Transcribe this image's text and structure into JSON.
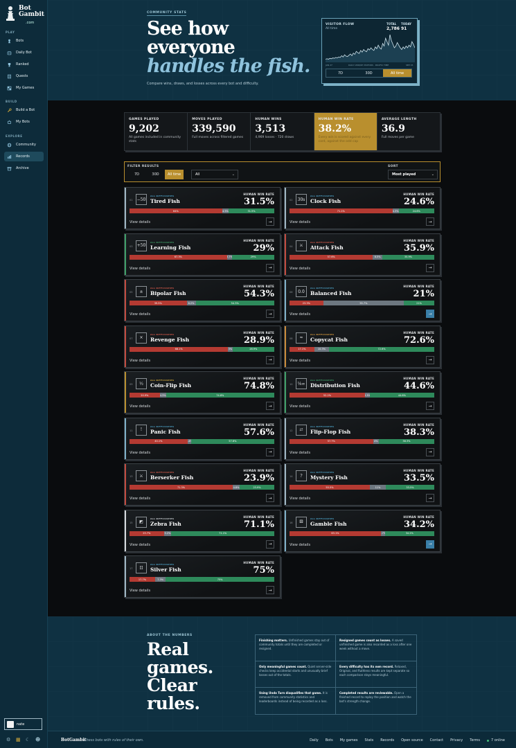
{
  "brand": {
    "line1": "Bot",
    "line2": "Gambit",
    "domain": ".com"
  },
  "sidebar": {
    "play_label": "PLAY",
    "build_label": "BUILD",
    "explore_label": "EXPLORE",
    "items": [
      {
        "label": "Bots",
        "icon": "pawn-icon"
      },
      {
        "label": "Daily Bot",
        "icon": "robot-icon"
      },
      {
        "label": "Ranked",
        "icon": "trophy-icon"
      },
      {
        "label": "Quests",
        "icon": "scroll-icon"
      },
      {
        "label": "My Games",
        "icon": "board-icon"
      },
      {
        "label": "Build a Bot",
        "icon": "wrench-icon"
      },
      {
        "label": "My Bots",
        "icon": "bot-icon"
      },
      {
        "label": "Community",
        "icon": "globe-icon"
      },
      {
        "label": "Records",
        "icon": "records-icon"
      },
      {
        "label": "Archive",
        "icon": "archive-icon"
      }
    ],
    "user": "nate"
  },
  "hero": {
    "eyebrow": "COMMUNITY STATS",
    "line1": "See how",
    "line2": "everyone",
    "line3": "handles the fish.",
    "subtitle": "Compare wins, draws, and losses across every bot and difficulty."
  },
  "flow": {
    "title": "VISITOR FLOW",
    "subtitle": "All time",
    "total_label": "TOTAL",
    "total_value": "2,786",
    "today_label": "TODAY",
    "today_value": "91",
    "caption_left": "JAN 27",
    "caption_mid": "DAILY UNIQUE VISITORS · PACIFIC TIME",
    "caption_right": "SEP 15",
    "ranges": [
      "7D",
      "30D",
      "All time"
    ],
    "selected": "All time",
    "visitors": [
      4,
      5,
      4,
      6,
      5,
      7,
      6,
      8,
      7,
      9,
      8,
      12,
      9,
      14,
      11,
      10,
      13,
      16,
      12,
      18,
      15,
      22,
      19,
      17,
      24,
      20,
      26,
      23,
      21,
      28,
      25,
      30,
      26,
      24,
      32,
      28,
      36,
      30,
      27,
      40,
      34,
      52,
      44,
      36,
      60,
      46,
      38,
      30,
      34,
      42,
      36,
      30,
      26,
      32,
      28,
      34,
      30,
      36,
      32,
      44,
      38,
      30
    ]
  },
  "stats": [
    {
      "label": "GAMES PLAYED",
      "value": "9,202",
      "caption": "All games included in community stats"
    },
    {
      "label": "MOVES PLAYED",
      "value": "339,590",
      "caption": "Full moves across filtered games"
    },
    {
      "label": "HUMAN WINS",
      "value": "3,513",
      "caption": "4,969 losses · 720 draws"
    },
    {
      "label": "HUMAN WIN RATE",
      "value": "38.2%",
      "caption": "Every win is scored against every card, against the odd cap"
    },
    {
      "label": "AVERAGE LENGTH",
      "value": "36.9",
      "caption": "Full moves per game"
    }
  ],
  "filter": {
    "label": "FILTER RESULTS",
    "ranges": [
      "7D",
      "30D",
      "All time"
    ],
    "selected": "All time",
    "difficulty": "All",
    "sort_label": "SORT",
    "sort_value": "Most played"
  },
  "card_labels": {
    "difficulty": "ALL DIFFICULTIES",
    "rate": "HUMAN WIN RATE",
    "details": "View details"
  },
  "bots": [
    {
      "no": "01",
      "glyph": "−50",
      "name": "Tired Fish",
      "rate": "31.5%",
      "loss": 64,
      "draw": 4.5,
      "win": 31.5,
      "loss_label": "64%",
      "draw_label": "4.5%",
      "win_label": "31.5%",
      "stripe": "#9fb6c3",
      "color": "#4da3c8"
    },
    {
      "no": "02",
      "glyph": "30s",
      "name": "Clock Fish",
      "rate": "24.6%",
      "loss": 71.1,
      "draw": 4.3,
      "win": 24.6,
      "loss_label": "71.1%",
      "draw_label": "4.3%",
      "win_label": "24.6%",
      "stripe": "#9fb6c3",
      "color": "#4da3c8"
    },
    {
      "no": "03",
      "glyph": "+50",
      "name": "Learning Fish",
      "rate": "29%",
      "loss": 67.3,
      "draw": 3.7,
      "win": 29,
      "loss_label": "67.3%",
      "draw_label": "3.7%",
      "win_label": "29%",
      "stripe": "#3f9e67",
      "color": "#3f9e67"
    },
    {
      "no": "04",
      "glyph": "⚔",
      "name": "Attack Fish",
      "rate": "35.9%",
      "loss": 57.6,
      "draw": 6.5,
      "win": 35.9,
      "loss_label": "57.6%",
      "draw_label": "6.5%",
      "win_label": "35.9%",
      "stripe": "#c24b3f",
      "color": "#d6594a"
    },
    {
      "no": "05",
      "glyph": "±",
      "name": "Bipolar Fish",
      "rate": "54.3%",
      "loss": 39.5,
      "draw": 6.2,
      "win": 54.3,
      "loss_label": "39.5%",
      "draw_label": "6.2%",
      "win_label": "54.3%",
      "stripe": "#c24b3f",
      "color": "#d6594a"
    },
    {
      "no": "06",
      "glyph": "0.0",
      "name": "Balanced Fish",
      "rate": "21%",
      "loss": 23.3,
      "draw": 55.7,
      "win": 21,
      "loss_label": "23.3%",
      "draw_label": "55.7%",
      "win_label": "21%",
      "stripe": "#7fb0c8",
      "color": "#4da3c8"
    },
    {
      "no": "07",
      "glyph": "×",
      "name": "Revenge Fish",
      "rate": "28.9%",
      "loss": 68.1,
      "draw": 3,
      "win": 28.9,
      "loss_label": "68.1%",
      "draw_label": "3%",
      "win_label": "28.9%",
      "stripe": "#c24b3f",
      "color": "#d6594a"
    },
    {
      "no": "08",
      "glyph": "≈",
      "name": "Copycat Fish",
      "rate": "72.6%",
      "loss": 17.1,
      "draw": 10.3,
      "win": 72.6,
      "loss_label": "17.1%",
      "draw_label": "10.3%",
      "win_label": "72.6%",
      "stripe": "#c98a3a",
      "color": "#d89a3e"
    },
    {
      "no": "09",
      "glyph": "½",
      "name": "Coin-Flip Fish",
      "rate": "74.8%",
      "loss": 20.9,
      "draw": 4.3,
      "win": 74.8,
      "loss_label": "20.9%",
      "draw_label": "4.3%",
      "win_label": "74.8%",
      "stripe": "#b98f2e",
      "color": "#d4aa3a"
    },
    {
      "no": "10",
      "glyph": "⅛∞",
      "name": "Distribution Fish",
      "rate": "44.6%",
      "loss": 52.2,
      "draw": 3.3,
      "win": 44.6,
      "loss_label": "52.2%",
      "draw_label": "3.3%",
      "win_label": "44.6%",
      "stripe": "#3f9e67",
      "color": "#3f9e67"
    },
    {
      "no": "11",
      "glyph": "!",
      "name": "Panic Fish",
      "rate": "57.6%",
      "loss": 40.1,
      "draw": 2.4,
      "win": 57.6,
      "loss_label": "40.1%",
      "draw_label": "2.4%",
      "win_label": "57.6%",
      "stripe": "#7fb0c8",
      "color": "#4da3c8"
    },
    {
      "no": "12",
      "glyph": "⇄",
      "name": "Flip-Flop Fish",
      "rate": "38.3%",
      "loss": 57.7,
      "draw": 4,
      "win": 38.3,
      "loss_label": "57.7%",
      "draw_label": "4%",
      "win_label": "38.3%",
      "stripe": "#9fb6c3",
      "color": "#4da3c8"
    },
    {
      "no": "13",
      "glyph": "⚔",
      "name": "Berserker Fish",
      "rate": "23.9%",
      "loss": 71.3,
      "draw": 4.8,
      "win": 23.9,
      "loss_label": "71.3%",
      "draw_label": "4.8%",
      "win_label": "23.9%",
      "stripe": "#c24b3f",
      "color": "#d6594a"
    },
    {
      "no": "14",
      "glyph": "?",
      "name": "Mystery Fish",
      "rate": "33.5%",
      "loss": 55.5,
      "draw": 11,
      "win": 33.5,
      "loss_label": "55.5%",
      "draw_label": "11%",
      "win_label": "33.5%",
      "stripe": "#9fb6c3",
      "color": "#4da3c8"
    },
    {
      "no": "15",
      "glyph": "◩",
      "name": "Zebra Fish",
      "rate": "71.1%",
      "loss": 23.7,
      "draw": 5.2,
      "win": 71.1,
      "loss_label": "23.7%",
      "draw_label": "5.2%",
      "win_label": "71.1%",
      "stripe": "#d5d9dc",
      "color": "#cfd4d8"
    },
    {
      "no": "16",
      "glyph": "⚄",
      "name": "Gamble Fish",
      "rate": "34.2%",
      "loss": 63.1,
      "draw": 2.7,
      "win": 34.2,
      "loss_label": "63.1%",
      "draw_label": "2.7%",
      "win_label": "34.2%",
      "stripe": "#7fb0c8",
      "color": "#4da3c8"
    },
    {
      "no": "17",
      "glyph": "II",
      "name": "Silver Fish",
      "rate": "75%",
      "loss": 17.7,
      "draw": 7.3,
      "win": 75,
      "loss_label": "17.7%",
      "draw_label": "7.3%",
      "win_label": "75%",
      "stripe": "#9fb6c3",
      "color": "#4da3c8"
    }
  ],
  "about": {
    "eyebrow": "ABOUT THE NUMBERS",
    "line1": "Real",
    "line2": "games.",
    "line3": "Clear",
    "line4": "rules.",
    "rules": [
      {
        "title": "Finishing matters.",
        "text": "Unfinished games stay out of community totals until they are completed or resigned."
      },
      {
        "title": "Resigned games count as losses.",
        "text": "A saved unfinished game is also recorded as a loss after one week without a move."
      },
      {
        "title": "Only meaningful games count.",
        "text": "Quiet server-side checks keep accidental starts and unusually brief losses out of the totals."
      },
      {
        "title": "Every difficulty has its own record.",
        "text": "Relaxed, Original, and Ruthless results are kept separate so each comparison stays meaningful."
      },
      {
        "title": "Using Undo Turn disqualifies that game.",
        "text": "It is removed from community statistics and leaderboards instead of being recorded as a loss."
      },
      {
        "title": "Completed results are reviewable.",
        "text": "Open a finished record to replay the position and watch the bot's strength change."
      }
    ]
  },
  "footer": {
    "brand": "BotGambit",
    "tagline": "Chess bots with rules of their own.",
    "links": [
      "Daily",
      "Bots",
      "My games",
      "Stats",
      "Records",
      "Open source",
      "Contact",
      "Privacy",
      "Terms"
    ],
    "online": "7 online"
  }
}
